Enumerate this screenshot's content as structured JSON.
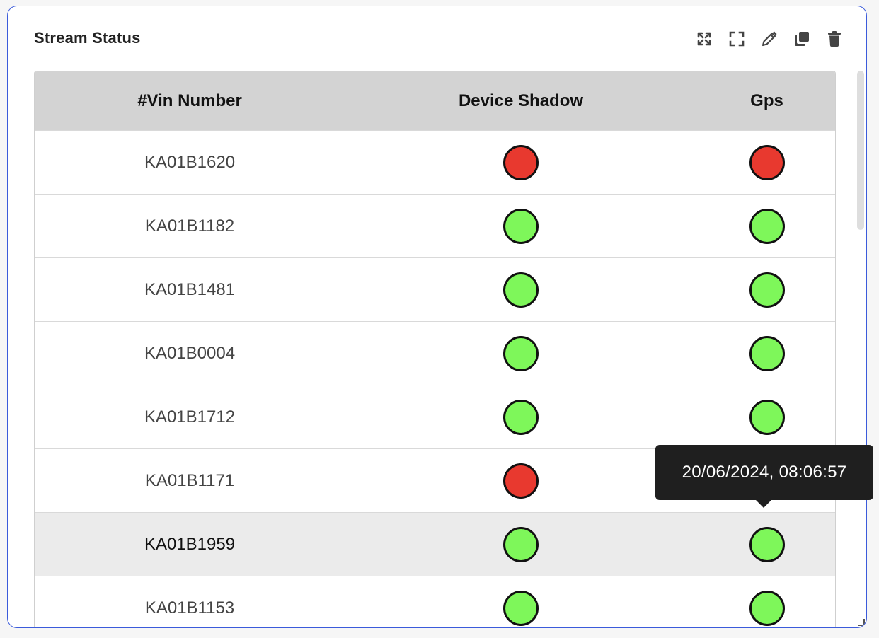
{
  "widget": {
    "title": "Stream Status"
  },
  "toolbar": {
    "icons": [
      "expand-arrows-icon",
      "fullscreen-icon",
      "edit-pencil-icon",
      "copy-icon",
      "trash-icon"
    ]
  },
  "table": {
    "columns": [
      "#Vin Number",
      "Device Shadow",
      "Gps"
    ],
    "rows": [
      {
        "vin": "KA01B1620",
        "device_shadow": "red",
        "gps": "red"
      },
      {
        "vin": "KA01B1182",
        "device_shadow": "green",
        "gps": "green"
      },
      {
        "vin": "KA01B1481",
        "device_shadow": "green",
        "gps": "green"
      },
      {
        "vin": "KA01B0004",
        "device_shadow": "green",
        "gps": "green"
      },
      {
        "vin": "KA01B1712",
        "device_shadow": "green",
        "gps": "green"
      },
      {
        "vin": "KA01B1171",
        "device_shadow": "red",
        "gps": "green"
      },
      {
        "vin": "KA01B1959",
        "device_shadow": "green",
        "gps": "green"
      },
      {
        "vin": "KA01B1153",
        "device_shadow": "green",
        "gps": "green"
      }
    ],
    "hovered_row": 6
  },
  "status_colors": {
    "red": "#e8392f",
    "green": "#7ef75a"
  },
  "tooltip": {
    "text": "20/06/2024, 08:06:57"
  }
}
